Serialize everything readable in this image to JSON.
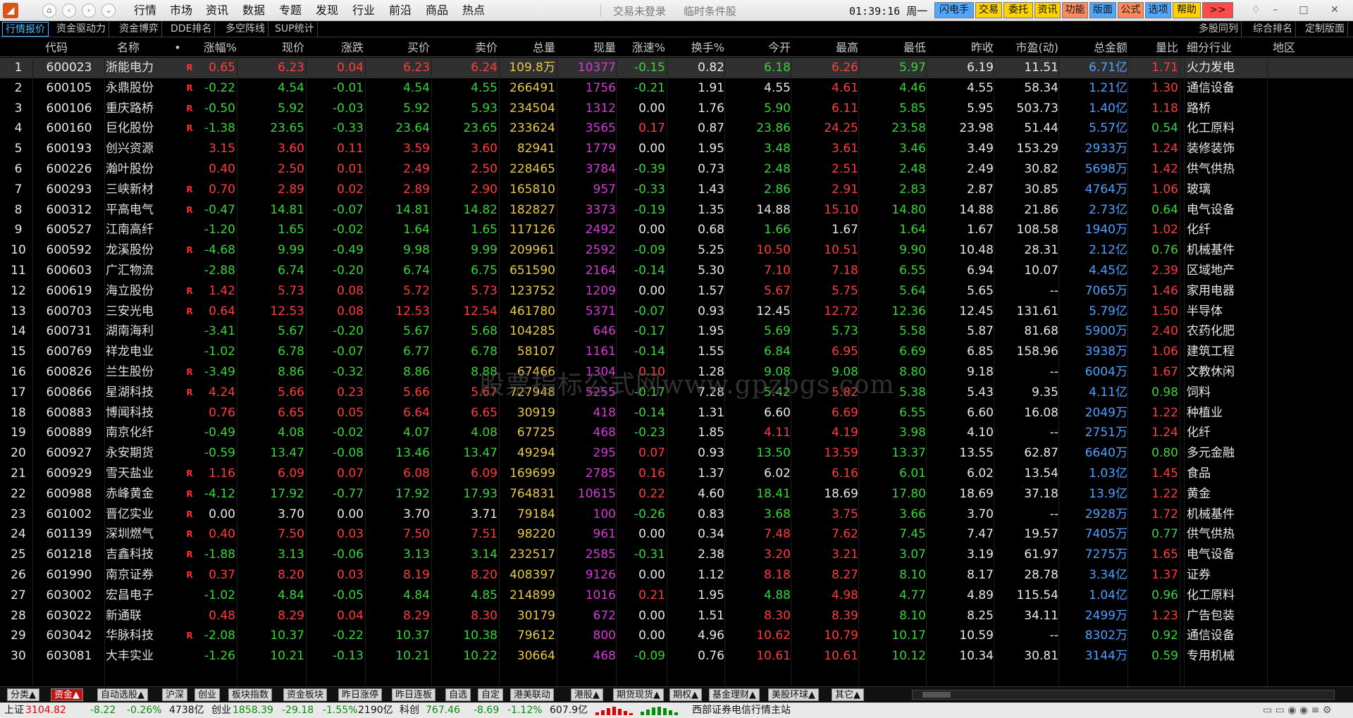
{
  "app": {
    "menu": [
      "行情",
      "市场",
      "资讯",
      "数据",
      "专题",
      "发现",
      "行业",
      "前沿",
      "商品",
      "热点"
    ],
    "status_login": "交易未登录",
    "status_cond": "临时条件股",
    "clock": "01:39:16",
    "weekday": "周一",
    "quick_buttons": [
      {
        "label": "闪电手",
        "bg": "#4fa8ff"
      },
      {
        "label": "交易",
        "bg": "#ffd200"
      },
      {
        "label": "委托",
        "bg": "#ffd200"
      },
      {
        "label": "资讯",
        "bg": "#ffd200"
      },
      {
        "label": "功能",
        "bg": "#ff8a5c"
      },
      {
        "label": "版面",
        "bg": "#4fa8ff"
      },
      {
        "label": "公式",
        "bg": "#ff8a5c"
      },
      {
        "label": "选项",
        "bg": "#4fa8ff"
      },
      {
        "label": "帮助",
        "bg": "#ffd200"
      },
      {
        "label": ">>",
        "bg": "#ff4a4a"
      }
    ]
  },
  "tabs": [
    "行情报价",
    "资金驱动力",
    "资金博弈",
    "DDE排名",
    "多空阵线",
    "SUP统计"
  ],
  "right_tabs": [
    "多股同列",
    "综合排名",
    "定制版面"
  ],
  "table": {
    "headers": [
      "",
      "代码",
      "名称",
      "•",
      "涨幅%",
      "现价",
      "涨跌",
      "买价",
      "卖价",
      "总量",
      "现量",
      "涨速%",
      "换手%",
      "今开",
      "最高",
      "最低",
      "昨收",
      "市盈(动)",
      "总金额",
      "量比",
      "细分行业",
      "地区"
    ],
    "rows": [
      {
        "n": "1",
        "code": "600023",
        "name": "浙能电力",
        "r": "R",
        "chg_pct": "0.65",
        "price": "6.23",
        "chg": "0.04",
        "bid": "6.23",
        "ask": "6.24",
        "vol": "109.8万",
        "cur": "10377",
        "speed": "-0.15",
        "turn": "0.82",
        "open": "6.18",
        "high": "6.26",
        "low": "5.97",
        "prev": "6.19",
        "pe": "11.51",
        "amt": "6.71亿",
        "vr": "1.71",
        "ind": "火力发电"
      },
      {
        "n": "2",
        "code": "600105",
        "name": "永鼎股份",
        "r": "R",
        "chg_pct": "-0.22",
        "price": "4.54",
        "chg": "-0.01",
        "bid": "4.54",
        "ask": "4.55",
        "vol": "266491",
        "cur": "1756",
        "speed": "-0.21",
        "turn": "1.91",
        "open": "4.55",
        "high": "4.61",
        "low": "4.46",
        "prev": "4.55",
        "pe": "58.34",
        "amt": "1.21亿",
        "vr": "1.30",
        "ind": "通信设备"
      },
      {
        "n": "3",
        "code": "600106",
        "name": "重庆路桥",
        "r": "R",
        "chg_pct": "-0.50",
        "price": "5.92",
        "chg": "-0.03",
        "bid": "5.92",
        "ask": "5.93",
        "vol": "234504",
        "cur": "1312",
        "speed": "0.00",
        "turn": "1.76",
        "open": "5.90",
        "high": "6.11",
        "low": "5.85",
        "prev": "5.95",
        "pe": "503.73",
        "amt": "1.40亿",
        "vr": "1.18",
        "ind": "路桥"
      },
      {
        "n": "4",
        "code": "600160",
        "name": "巨化股份",
        "r": "R",
        "chg_pct": "-1.38",
        "price": "23.65",
        "chg": "-0.33",
        "bid": "23.64",
        "ask": "23.65",
        "vol": "233624",
        "cur": "3565",
        "speed": "0.17",
        "turn": "0.87",
        "open": "23.86",
        "high": "24.25",
        "low": "23.58",
        "prev": "23.98",
        "pe": "51.44",
        "amt": "5.57亿",
        "vr": "0.54",
        "ind": "化工原料"
      },
      {
        "n": "5",
        "code": "600193",
        "name": "创兴资源",
        "r": "",
        "chg_pct": "3.15",
        "price": "3.60",
        "chg": "0.11",
        "bid": "3.59",
        "ask": "3.60",
        "vol": "82941",
        "cur": "1779",
        "speed": "0.00",
        "turn": "1.95",
        "open": "3.48",
        "high": "3.61",
        "low": "3.46",
        "prev": "3.49",
        "pe": "153.29",
        "amt": "2933万",
        "vr": "1.24",
        "ind": "装修装饰"
      },
      {
        "n": "6",
        "code": "600226",
        "name": "瀚叶股份",
        "r": "",
        "chg_pct": "0.40",
        "price": "2.50",
        "chg": "0.01",
        "bid": "2.49",
        "ask": "2.50",
        "vol": "228465",
        "cur": "3784",
        "speed": "-0.39",
        "turn": "0.73",
        "open": "2.48",
        "high": "2.51",
        "low": "2.48",
        "prev": "2.49",
        "pe": "30.82",
        "amt": "5698万",
        "vr": "1.42",
        "ind": "供气供热"
      },
      {
        "n": "7",
        "code": "600293",
        "name": "三峡新材",
        "r": "R",
        "chg_pct": "0.70",
        "price": "2.89",
        "chg": "0.02",
        "bid": "2.89",
        "ask": "2.90",
        "vol": "165810",
        "cur": "957",
        "speed": "-0.33",
        "turn": "1.43",
        "open": "2.86",
        "high": "2.91",
        "low": "2.83",
        "prev": "2.87",
        "pe": "30.85",
        "amt": "4764万",
        "vr": "1.06",
        "ind": "玻璃"
      },
      {
        "n": "8",
        "code": "600312",
        "name": "平高电气",
        "r": "R",
        "chg_pct": "-0.47",
        "price": "14.81",
        "chg": "-0.07",
        "bid": "14.81",
        "ask": "14.82",
        "vol": "182827",
        "cur": "3373",
        "speed": "-0.19",
        "turn": "1.35",
        "open": "14.88",
        "high": "15.10",
        "low": "14.80",
        "prev": "14.88",
        "pe": "21.86",
        "amt": "2.73亿",
        "vr": "0.64",
        "ind": "电气设备"
      },
      {
        "n": "9",
        "code": "600527",
        "name": "江南高纤",
        "r": "",
        "chg_pct": "-1.20",
        "price": "1.65",
        "chg": "-0.02",
        "bid": "1.64",
        "ask": "1.65",
        "vol": "117126",
        "cur": "2492",
        "speed": "0.00",
        "turn": "0.68",
        "open": "1.66",
        "high": "1.67",
        "low": "1.64",
        "prev": "1.67",
        "pe": "108.58",
        "amt": "1940万",
        "vr": "1.02",
        "ind": "化纤"
      },
      {
        "n": "10",
        "code": "600592",
        "name": "龙溪股份",
        "r": "R",
        "chg_pct": "-4.68",
        "price": "9.99",
        "chg": "-0.49",
        "bid": "9.98",
        "ask": "9.99",
        "vol": "209961",
        "cur": "2592",
        "speed": "-0.09",
        "turn": "5.25",
        "open": "10.50",
        "high": "10.51",
        "low": "9.90",
        "prev": "10.48",
        "pe": "28.31",
        "amt": "2.12亿",
        "vr": "0.76",
        "ind": "机械基件"
      },
      {
        "n": "11",
        "code": "600603",
        "name": "广汇物流",
        "r": "",
        "chg_pct": "-2.88",
        "price": "6.74",
        "chg": "-0.20",
        "bid": "6.74",
        "ask": "6.75",
        "vol": "651590",
        "cur": "2164",
        "speed": "-0.14",
        "turn": "5.30",
        "open": "7.10",
        "high": "7.18",
        "low": "6.55",
        "prev": "6.94",
        "pe": "10.07",
        "amt": "4.45亿",
        "vr": "2.39",
        "ind": "区域地产"
      },
      {
        "n": "12",
        "code": "600619",
        "name": "海立股份",
        "r": "R",
        "chg_pct": "1.42",
        "price": "5.73",
        "chg": "0.08",
        "bid": "5.72",
        "ask": "5.73",
        "vol": "123752",
        "cur": "1209",
        "speed": "0.00",
        "turn": "1.57",
        "open": "5.67",
        "high": "5.75",
        "low": "5.64",
        "prev": "5.65",
        "pe": "--",
        "amt": "7065万",
        "vr": "1.46",
        "ind": "家用电器"
      },
      {
        "n": "13",
        "code": "600703",
        "name": "三安光电",
        "r": "R",
        "chg_pct": "0.64",
        "price": "12.53",
        "chg": "0.08",
        "bid": "12.53",
        "ask": "12.54",
        "vol": "461780",
        "cur": "5371",
        "speed": "-0.07",
        "turn": "0.93",
        "open": "12.45",
        "high": "12.72",
        "low": "12.36",
        "prev": "12.45",
        "pe": "131.61",
        "amt": "5.79亿",
        "vr": "1.50",
        "ind": "半导体"
      },
      {
        "n": "14",
        "code": "600731",
        "name": "湖南海利",
        "r": "",
        "chg_pct": "-3.41",
        "price": "5.67",
        "chg": "-0.20",
        "bid": "5.67",
        "ask": "5.68",
        "vol": "104285",
        "cur": "646",
        "speed": "-0.17",
        "turn": "1.95",
        "open": "5.69",
        "high": "5.73",
        "low": "5.58",
        "prev": "5.87",
        "pe": "81.68",
        "amt": "5900万",
        "vr": "2.40",
        "ind": "农药化肥"
      },
      {
        "n": "15",
        "code": "600769",
        "name": "祥龙电业",
        "r": "",
        "chg_pct": "-1.02",
        "price": "6.78",
        "chg": "-0.07",
        "bid": "6.77",
        "ask": "6.78",
        "vol": "58107",
        "cur": "1161",
        "speed": "-0.14",
        "turn": "1.55",
        "open": "6.84",
        "high": "6.95",
        "low": "6.69",
        "prev": "6.85",
        "pe": "158.96",
        "amt": "3938万",
        "vr": "1.06",
        "ind": "建筑工程"
      },
      {
        "n": "16",
        "code": "600826",
        "name": "兰生股份",
        "r": "R",
        "chg_pct": "-3.49",
        "price": "8.86",
        "chg": "-0.32",
        "bid": "8.86",
        "ask": "8.88",
        "vol": "67466",
        "cur": "1304",
        "speed": "0.10",
        "turn": "1.28",
        "open": "9.08",
        "high": "9.08",
        "low": "8.80",
        "prev": "9.18",
        "pe": "--",
        "amt": "6004万",
        "vr": "1.67",
        "ind": "文教休闲"
      },
      {
        "n": "17",
        "code": "600866",
        "name": "星湖科技",
        "r": "R",
        "chg_pct": "4.24",
        "price": "5.66",
        "chg": "0.23",
        "bid": "5.66",
        "ask": "5.67",
        "vol": "727948",
        "cur": "5255",
        "speed": "-0.17",
        "turn": "7.28",
        "open": "5.42",
        "high": "5.82",
        "low": "5.38",
        "prev": "5.43",
        "pe": "9.35",
        "amt": "4.11亿",
        "vr": "0.98",
        "ind": "饲料"
      },
      {
        "n": "18",
        "code": "600883",
        "name": "博闻科技",
        "r": "",
        "chg_pct": "0.76",
        "price": "6.65",
        "chg": "0.05",
        "bid": "6.64",
        "ask": "6.65",
        "vol": "30919",
        "cur": "418",
        "speed": "-0.14",
        "turn": "1.31",
        "open": "6.60",
        "high": "6.69",
        "low": "6.55",
        "prev": "6.60",
        "pe": "16.08",
        "amt": "2049万",
        "vr": "1.22",
        "ind": "种植业"
      },
      {
        "n": "19",
        "code": "600889",
        "name": "南京化纤",
        "r": "",
        "chg_pct": "-0.49",
        "price": "4.08",
        "chg": "-0.02",
        "bid": "4.07",
        "ask": "4.08",
        "vol": "67725",
        "cur": "468",
        "speed": "-0.23",
        "turn": "1.85",
        "open": "4.11",
        "high": "4.19",
        "low": "3.98",
        "prev": "4.10",
        "pe": "--",
        "amt": "2751万",
        "vr": "1.24",
        "ind": "化纤"
      },
      {
        "n": "20",
        "code": "600927",
        "name": "永安期货",
        "r": "",
        "chg_pct": "-0.59",
        "price": "13.47",
        "chg": "-0.08",
        "bid": "13.46",
        "ask": "13.47",
        "vol": "49294",
        "cur": "295",
        "speed": "0.07",
        "turn": "0.93",
        "open": "13.50",
        "high": "13.59",
        "low": "13.37",
        "prev": "13.55",
        "pe": "62.87",
        "amt": "6640万",
        "vr": "0.80",
        "ind": "多元金融"
      },
      {
        "n": "21",
        "code": "600929",
        "name": "雪天盐业",
        "r": "R",
        "chg_pct": "1.16",
        "price": "6.09",
        "chg": "0.07",
        "bid": "6.08",
        "ask": "6.09",
        "vol": "169699",
        "cur": "2785",
        "speed": "0.16",
        "turn": "1.37",
        "open": "6.02",
        "high": "6.16",
        "low": "6.01",
        "prev": "6.02",
        "pe": "13.54",
        "amt": "1.03亿",
        "vr": "1.45",
        "ind": "食品"
      },
      {
        "n": "22",
        "code": "600988",
        "name": "赤峰黄金",
        "r": "R",
        "chg_pct": "-4.12",
        "price": "17.92",
        "chg": "-0.77",
        "bid": "17.92",
        "ask": "17.93",
        "vol": "764831",
        "cur": "10615",
        "speed": "0.22",
        "turn": "4.60",
        "open": "18.41",
        "high": "18.69",
        "low": "17.80",
        "prev": "18.69",
        "pe": "37.18",
        "amt": "13.9亿",
        "vr": "1.22",
        "ind": "黄金"
      },
      {
        "n": "23",
        "code": "601002",
        "name": "晋亿实业",
        "r": "R",
        "chg_pct": "0.00",
        "price": "3.70",
        "chg": "0.00",
        "bid": "3.70",
        "ask": "3.71",
        "vol": "79184",
        "cur": "100",
        "speed": "-0.26",
        "turn": "0.83",
        "open": "3.68",
        "high": "3.75",
        "low": "3.66",
        "prev": "3.70",
        "pe": "--",
        "amt": "2928万",
        "vr": "1.72",
        "ind": "机械基件"
      },
      {
        "n": "24",
        "code": "601139",
        "name": "深圳燃气",
        "r": "R",
        "chg_pct": "0.40",
        "price": "7.50",
        "chg": "0.03",
        "bid": "7.50",
        "ask": "7.51",
        "vol": "98220",
        "cur": "961",
        "speed": "0.00",
        "turn": "0.34",
        "open": "7.48",
        "high": "7.62",
        "low": "7.45",
        "prev": "7.47",
        "pe": "19.57",
        "amt": "7405万",
        "vr": "0.77",
        "ind": "供气供热"
      },
      {
        "n": "25",
        "code": "601218",
        "name": "吉鑫科技",
        "r": "R",
        "chg_pct": "-1.88",
        "price": "3.13",
        "chg": "-0.06",
        "bid": "3.13",
        "ask": "3.14",
        "vol": "232517",
        "cur": "2585",
        "speed": "-0.31",
        "turn": "2.38",
        "open": "3.20",
        "high": "3.21",
        "low": "3.07",
        "prev": "3.19",
        "pe": "61.97",
        "amt": "7275万",
        "vr": "1.65",
        "ind": "电气设备"
      },
      {
        "n": "26",
        "code": "601990",
        "name": "南京证券",
        "r": "R",
        "chg_pct": "0.37",
        "price": "8.20",
        "chg": "0.03",
        "bid": "8.19",
        "ask": "8.20",
        "vol": "408397",
        "cur": "9126",
        "speed": "0.00",
        "turn": "1.12",
        "open": "8.18",
        "high": "8.27",
        "low": "8.10",
        "prev": "8.17",
        "pe": "28.78",
        "amt": "3.34亿",
        "vr": "1.37",
        "ind": "证券"
      },
      {
        "n": "27",
        "code": "603002",
        "name": "宏昌电子",
        "r": "",
        "chg_pct": "-1.02",
        "price": "4.84",
        "chg": "-0.05",
        "bid": "4.84",
        "ask": "4.85",
        "vol": "214899",
        "cur": "1016",
        "speed": "0.21",
        "turn": "1.95",
        "open": "4.88",
        "high": "4.98",
        "low": "4.77",
        "prev": "4.89",
        "pe": "115.54",
        "amt": "1.04亿",
        "vr": "0.96",
        "ind": "化工原料"
      },
      {
        "n": "28",
        "code": "603022",
        "name": "新通联",
        "r": "",
        "chg_pct": "0.48",
        "price": "8.29",
        "chg": "0.04",
        "bid": "8.29",
        "ask": "8.30",
        "vol": "30179",
        "cur": "672",
        "speed": "0.00",
        "turn": "1.51",
        "open": "8.30",
        "high": "8.39",
        "low": "8.10",
        "prev": "8.25",
        "pe": "34.11",
        "amt": "2499万",
        "vr": "1.23",
        "ind": "广告包装"
      },
      {
        "n": "29",
        "code": "603042",
        "name": "华脉科技",
        "r": "R",
        "chg_pct": "-2.08",
        "price": "10.37",
        "chg": "-0.22",
        "bid": "10.37",
        "ask": "10.38",
        "vol": "79612",
        "cur": "800",
        "speed": "0.00",
        "turn": "4.96",
        "open": "10.62",
        "high": "10.79",
        "low": "10.17",
        "prev": "10.59",
        "pe": "--",
        "amt": "8302万",
        "vr": "0.92",
        "ind": "通信设备"
      },
      {
        "n": "30",
        "code": "603081",
        "name": "大丰实业",
        "r": "",
        "chg_pct": "-1.26",
        "price": "10.21",
        "chg": "-0.13",
        "bid": "10.21",
        "ask": "10.22",
        "vol": "30664",
        "cur": "468",
        "speed": "-0.09",
        "turn": "0.76",
        "open": "10.61",
        "high": "10.61",
        "low": "10.12",
        "prev": "10.34",
        "pe": "30.81",
        "amt": "3144万",
        "vr": "0.59",
        "ind": "专用机械"
      }
    ]
  },
  "watermark": "股票指标公式网www.gpzbgs.com",
  "bottom_tabs": [
    "分类▲",
    "资金▲",
    "自动选股▲",
    "沪深",
    "创业",
    "板块指数",
    "资金板块",
    "昨日涨停",
    "昨日连板",
    "自选",
    "自定",
    "港美联动",
    "港股▲",
    "期货现货▲",
    "期权▲",
    "基金理财▲",
    "美股环球▲",
    "其它▲"
  ],
  "statusbar": {
    "sh_label": "上证",
    "sh_val": "3104.82",
    "sh_chg": "-8.22",
    "sh_pct": "-0.26%",
    "sh_amt": "4738亿",
    "cy_label": "创业",
    "cy_val": "1858.39",
    "cy_chg": "-29.18",
    "cy_pct": "-1.55%",
    "cy_amt": "2190亿",
    "kc_label": "科创",
    "kc_val": "767.46",
    "kc_chg": "-8.69",
    "kc_pct": "-1.12%",
    "kc_amt": "607.9亿",
    "server": "西部证券电信行情主站"
  },
  "colors": {
    "up": "#ff3c3c",
    "down": "#3cd23c",
    "flat": "#e8e8e8",
    "volume": "#e8c84a",
    "cur_vol": "#d23cd2",
    "amount": "#4fa0ff"
  }
}
